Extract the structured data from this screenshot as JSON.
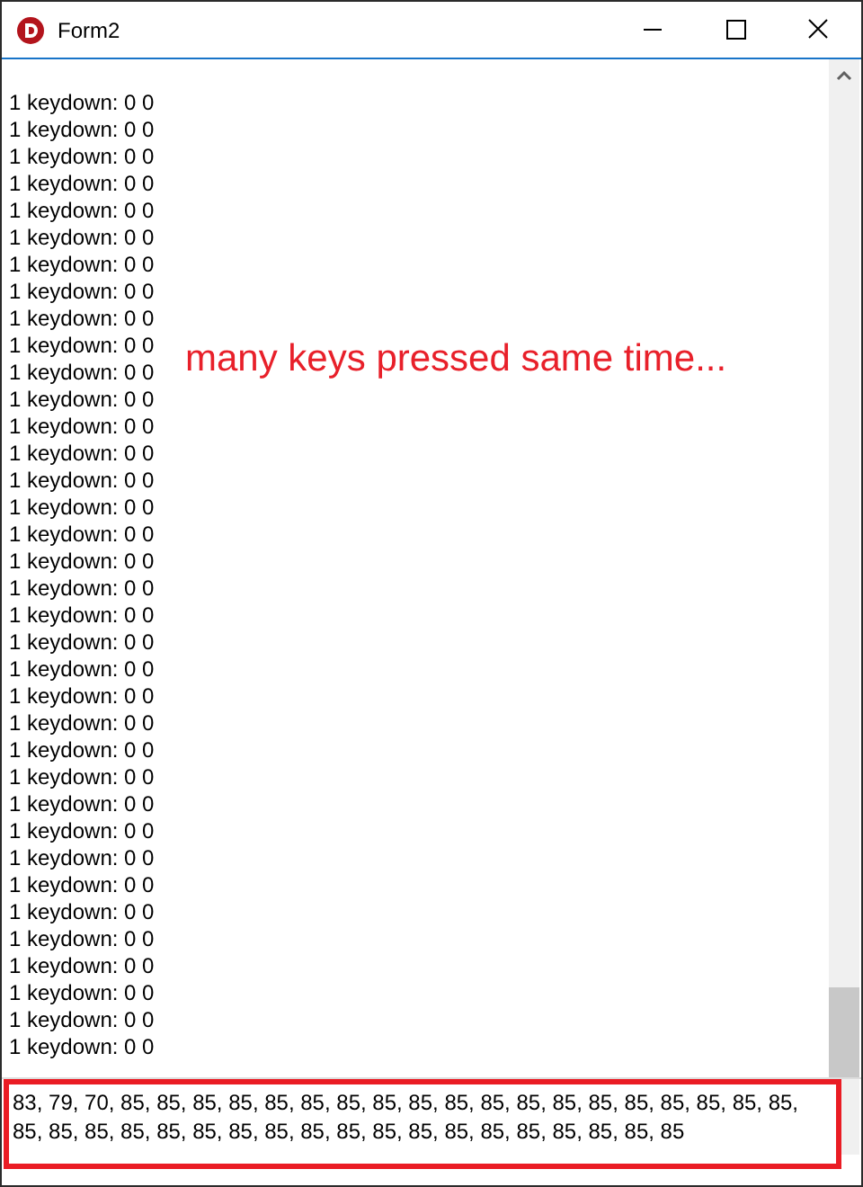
{
  "window": {
    "title": "Form2"
  },
  "log": {
    "lines": [
      "1 keydown: 0 0",
      "1 keydown: 0 0",
      "1 keydown: 0 0",
      "1 keydown: 0 0",
      "1 keydown: 0 0",
      "1 keydown: 0 0",
      "1 keydown: 0 0",
      "1 keydown: 0 0",
      "1 keydown: 0 0",
      "1 keydown: 0 0",
      "1 keydown: 0 0",
      "1 keydown: 0 0",
      "1 keydown: 0 0",
      "1 keydown: 0 0",
      "1 keydown: 0 0",
      "1 keydown: 0 0",
      "1 keydown: 0 0",
      "1 keydown: 0 0",
      "1 keydown: 0 0",
      "1 keydown: 0 0",
      "1 keydown: 0 0",
      "1 keydown: 0 0",
      "1 keydown: 0 0",
      "1 keydown: 0 0",
      "1 keydown: 0 0",
      "1 keydown: 0 0",
      "1 keydown: 0 0",
      "1 keydown: 0 0",
      "1 keydown: 0 0",
      "1 keydown: 0 0",
      "1 keydown: 0 0",
      "1 keydown: 0 0",
      "1 keydown: 0 0",
      "1 keydown: 0 0",
      "1 keydown: 0 0",
      "1 keydown: 0 0"
    ]
  },
  "annotation": "many keys pressed same time...",
  "keys_memo": {
    "value": " 83, 79, 70, 85, 85, 85, 85, 85, 85, 85, 85, 85, 85, 85, 85, 85, 85, 85, 85, 85, 85, 85, 85, 85, 85, 85, 85, 85, 85, 85, 85, 85, 85, 85, 85, 85, 85, 85, 85, 85, 85"
  }
}
